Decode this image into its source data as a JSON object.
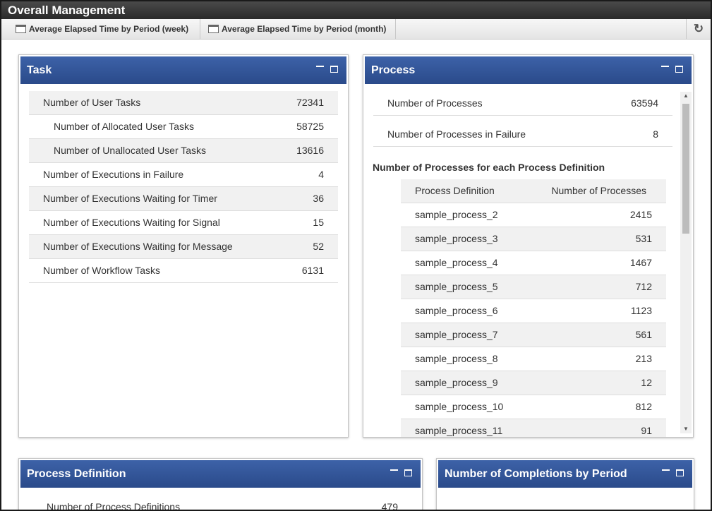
{
  "window": {
    "title": "Overall Management"
  },
  "toolbar": {
    "weekly_label": "Average Elapsed Time by Period (week)",
    "monthly_label": "Average Elapsed Time by Period (month)",
    "refresh_glyph": "↻"
  },
  "task_panel": {
    "title": "Task",
    "rows": [
      {
        "label": "Number of User Tasks",
        "value": "72341"
      },
      {
        "label": "Number of Allocated User Tasks",
        "value": "58725"
      },
      {
        "label": "Number of Unallocated User Tasks",
        "value": "13616"
      },
      {
        "label": "Number of Executions in Failure",
        "value": "4"
      },
      {
        "label": "Number of Executions Waiting for Timer",
        "value": "36"
      },
      {
        "label": "Number of Executions Waiting for Signal",
        "value": "15"
      },
      {
        "label": "Number of Executions Waiting for Message",
        "value": "52"
      },
      {
        "label": "Number of Workflow Tasks",
        "value": "6131"
      }
    ]
  },
  "process_panel": {
    "title": "Process",
    "rows": [
      {
        "label": "Number of Processes",
        "value": "63594"
      },
      {
        "label": "Number of Processes in Failure",
        "value": "8"
      }
    ],
    "definitions_title": "Number of Processes for each Process Definition",
    "table": {
      "headers": [
        "Process Definition",
        "Number of Processes"
      ],
      "rows": [
        {
          "name": "sample_process_2",
          "count": "2415"
        },
        {
          "name": "sample_process_3",
          "count": "531"
        },
        {
          "name": "sample_process_4",
          "count": "1467"
        },
        {
          "name": "sample_process_5",
          "count": "712"
        },
        {
          "name": "sample_process_6",
          "count": "1123"
        },
        {
          "name": "sample_process_7",
          "count": "561"
        },
        {
          "name": "sample_process_8",
          "count": "213"
        },
        {
          "name": "sample_process_9",
          "count": "12"
        },
        {
          "name": "sample_process_10",
          "count": "812"
        },
        {
          "name": "sample_process_11",
          "count": "91"
        }
      ]
    }
  },
  "definition_panel": {
    "title": "Process Definition",
    "rows": [
      {
        "label": "Number of Process Definitions",
        "value": "479"
      }
    ]
  },
  "completions_panel": {
    "title": "Number of Completions by Period"
  },
  "colors": {
    "panel_header": "#2f508f",
    "row_shade": "#f1f1f1",
    "titlebar": "#333333"
  },
  "icons": {
    "refresh": "refresh-icon",
    "window": "window-icon",
    "minimize": "minimize-icon",
    "maximize": "maximize-icon"
  }
}
